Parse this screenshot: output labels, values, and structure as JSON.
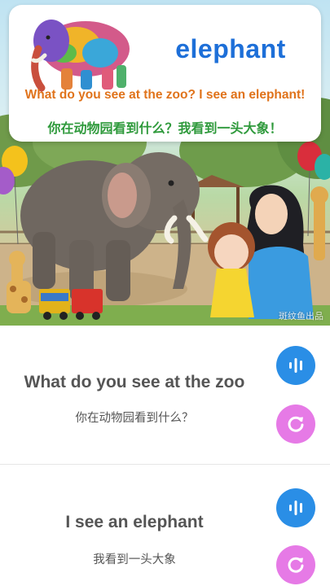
{
  "card": {
    "word": "elephant",
    "sentence_en": "What do you see at the zoo? I see an elephant!",
    "sentence_cn": "你在动物园看到什么？我看到一头大象！"
  },
  "watermark": "斑纹鱼出品",
  "sentences": [
    {
      "en": "What do you see at the zoo",
      "cn": "你在动物园看到什么？",
      "audio_icon": "audio-wave-icon",
      "replay_icon": "replay-icon"
    },
    {
      "en": "I see an elephant",
      "cn": "我看到一头大象",
      "audio_icon": "audio-wave-icon",
      "replay_icon": "replay-icon"
    }
  ],
  "colors": {
    "audio_button": "#2a8ee6",
    "replay_button": "#e67ae6",
    "word_title": "#1d6fd8",
    "sentence_en": "#e0731b",
    "sentence_cn": "#2f9a3c"
  }
}
